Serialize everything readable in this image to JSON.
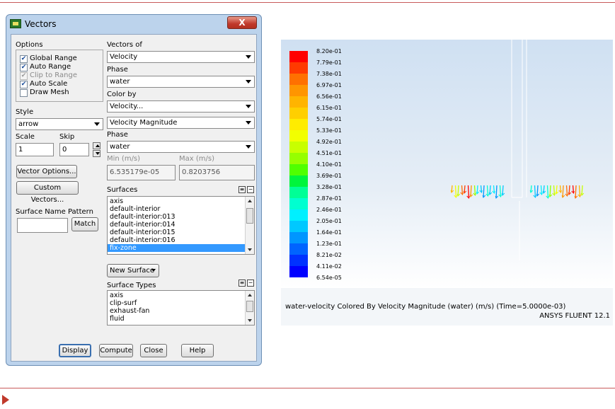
{
  "dialog": {
    "title": "Vectors",
    "close_glyph": "X",
    "options_label": "Options",
    "options": [
      {
        "label": "Global Range",
        "checked": true,
        "disabled": false
      },
      {
        "label": "Auto Range",
        "checked": true,
        "disabled": false
      },
      {
        "label": "Clip to Range",
        "checked": true,
        "disabled": true
      },
      {
        "label": "Auto Scale",
        "checked": true,
        "disabled": false
      },
      {
        "label": "Draw Mesh",
        "checked": false,
        "disabled": false
      }
    ],
    "style_label": "Style",
    "style_value": "arrow",
    "scale_label": "Scale",
    "scale_value": "1",
    "skip_label": "Skip",
    "skip_value": "0",
    "vector_options_button": "Vector Options...",
    "custom_vectors_button": "Custom Vectors...",
    "surface_name_pattern_label": "Surface Name Pattern",
    "surface_name_pattern_value": "",
    "match_button": "Match",
    "vectors_of_label": "Vectors of",
    "vectors_of_value": "Velocity",
    "phase1_label": "Phase",
    "phase1_value": "water",
    "color_by_label": "Color by",
    "color_by_value": "Velocity...",
    "color_by_sub_value": "Velocity Magnitude",
    "phase2_label": "Phase",
    "phase2_value": "water",
    "min_label": "Min (m/s)",
    "min_value": "6.535179e-05",
    "max_label": "Max (m/s)",
    "max_value": "0.8203756",
    "surfaces_label": "Surfaces",
    "surfaces": [
      {
        "label": "axis",
        "selected": false
      },
      {
        "label": "default-interior",
        "selected": false
      },
      {
        "label": "default-interior:013",
        "selected": false
      },
      {
        "label": "default-interior:014",
        "selected": false
      },
      {
        "label": "default-interior:015",
        "selected": false
      },
      {
        "label": "default-interior:016",
        "selected": false
      },
      {
        "label": "fix-zone",
        "selected": true
      }
    ],
    "new_surface_button": "New Surface",
    "surface_types_label": "Surface Types",
    "surface_types": [
      "axis",
      "clip-surf",
      "exhaust-fan",
      "fluid"
    ],
    "display_button": "Display",
    "compute_button": "Compute",
    "close_button": "Close",
    "help_button": "Help"
  },
  "plot": {
    "colorbar_ticks": [
      "8.20e-01",
      "7.79e-01",
      "7.38e-01",
      "6.97e-01",
      "6.56e-01",
      "6.15e-01",
      "5.74e-01",
      "5.33e-01",
      "4.92e-01",
      "4.51e-01",
      "4.10e-01",
      "3.69e-01",
      "3.28e-01",
      "2.87e-01",
      "2.46e-01",
      "2.05e-01",
      "1.64e-01",
      "1.23e-01",
      "8.21e-02",
      "4.11e-02",
      "6.54e-05"
    ],
    "colorbar_colors": [
      "#ff0000",
      "#ff3a00",
      "#ff7000",
      "#ff9500",
      "#ffb400",
      "#ffcf00",
      "#ffec00",
      "#f2ff00",
      "#c8ff00",
      "#96ff00",
      "#50ff00",
      "#00f53c",
      "#00ff96",
      "#00ffd0",
      "#00f0ff",
      "#00c8ff",
      "#0096ff",
      "#0064ff",
      "#0032ff",
      "#0000ff"
    ],
    "caption": "water-velocity Colored By Velocity Magnitude (water)  (m/s)  (Time=5.0000e-03)",
    "caption_right": "ANSYS FLUENT 12.1",
    "vector_colors": [
      "#ffb400",
      "#f2ff00",
      "#c8ff00",
      "#ff7000",
      "#ff3a00",
      "#ff0000",
      "#ff9500",
      "#96ff00",
      "#00f0ff",
      "#00c8ff",
      "#0096ff",
      "#00ffd0"
    ]
  }
}
